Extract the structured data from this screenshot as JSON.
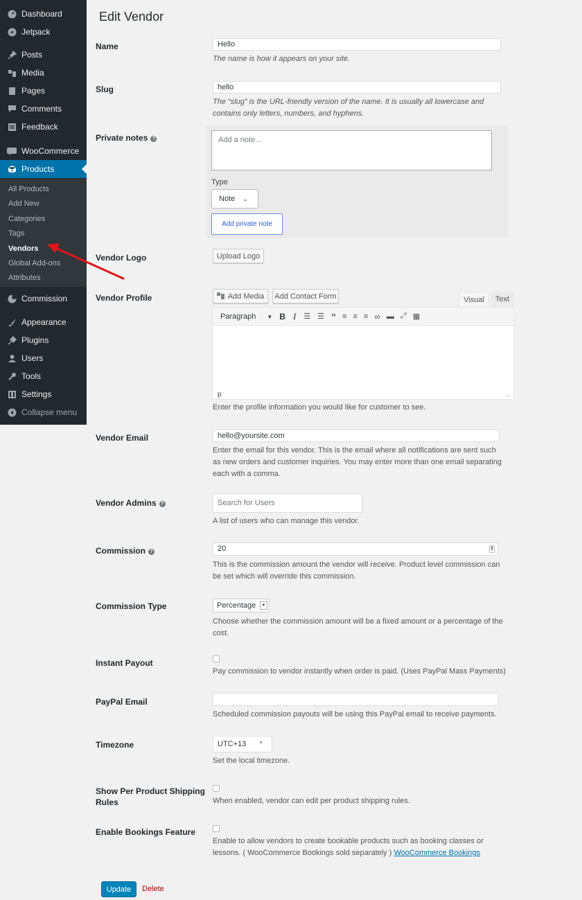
{
  "sidebar": {
    "menu": [
      {
        "label": "Dashboard",
        "icon": "dashboard-icon"
      },
      {
        "label": "Jetpack",
        "icon": "jetpack-icon"
      },
      {
        "label": "Posts",
        "icon": "pin-icon"
      },
      {
        "label": "Media",
        "icon": "media-icon"
      },
      {
        "label": "Pages",
        "icon": "page-icon"
      },
      {
        "label": "Comments",
        "icon": "comment-icon"
      },
      {
        "label": "Feedback",
        "icon": "feedback-icon"
      },
      {
        "label": "WooCommerce",
        "icon": "woocommerce-icon"
      },
      {
        "label": "Products",
        "icon": "products-icon"
      }
    ],
    "submenu": [
      "All Products",
      "Add New",
      "Categories",
      "Tags",
      "Vendors",
      "Global Add-ons",
      "Attributes"
    ],
    "menu2": [
      {
        "label": "Commission",
        "icon": "pie-chart-icon"
      },
      {
        "label": "Appearance",
        "icon": "brush-icon"
      },
      {
        "label": "Plugins",
        "icon": "plugin-icon"
      },
      {
        "label": "Users",
        "icon": "users-icon"
      },
      {
        "label": "Tools",
        "icon": "wrench-icon"
      },
      {
        "label": "Settings",
        "icon": "settings-icon"
      },
      {
        "label": "Collapse menu",
        "icon": "collapse-icon"
      }
    ]
  },
  "page": {
    "title": "Edit Vendor",
    "name": {
      "label": "Name",
      "value": "Hello",
      "desc": "The name is how it appears on your site."
    },
    "slug": {
      "label": "Slug",
      "value": "hello",
      "desc1": "The “slug” is the URL-friendly version of the name. It is usually all lowercase and",
      "desc2": "contains only letters, numbers, and hyphens."
    },
    "notes": {
      "label": "Private notes",
      "placeholder": "Add a note...",
      "type_label": "Type",
      "type_value": "Note",
      "add_button": "Add private note"
    },
    "logo": {
      "label": "Vendor Logo",
      "button": "Upload Logo"
    },
    "profile": {
      "label": "Vendor Profile",
      "add_media": "Add Media",
      "add_contact": "Add Contact Form",
      "tab_visual": "Visual",
      "tab_text": "Text",
      "format": "Paragraph",
      "path": "p",
      "desc": "Enter the profile information you would like for customer to see."
    },
    "email": {
      "label": "Vendor Email",
      "value": "hello@yoursite.com",
      "desc1": "Enter the email for this vendor. This is the email where all notifications are sent such",
      "desc2": "as new orders and customer inquiries. You may enter more than one email separating",
      "desc3": "each with a comma."
    },
    "admins": {
      "label": "Vendor Admins",
      "placeholder": "Search for Users",
      "desc": "A list of users who can manage this vendor."
    },
    "commission": {
      "label": "Commission",
      "value": "20",
      "desc1": "This is the commission amount the vendor will receive. Product level commission can",
      "desc2": "be set which will override this commission."
    },
    "commission_type": {
      "label": "Commission Type",
      "value": "Percentage",
      "desc1": "Choose whether the commission amount will be a fixed amount or a percentage of the",
      "desc2": "cost."
    },
    "instant_payout": {
      "label": "Instant Payout",
      "desc": "Pay commission to vendor instantly when order is paid. (Uses PayPal Mass Payments)"
    },
    "paypal": {
      "label": "PayPal Email",
      "value": "",
      "desc": "Scheduled commission payouts will be using this PayPal email to receive payments."
    },
    "timezone": {
      "label": "Timezone",
      "value": "UTC+13",
      "desc": "Set the local timezone."
    },
    "shipping": {
      "label1": "Show Per Product Shipping",
      "label2": "Rules",
      "desc": "When enabled, vendor can edit per product shipping rules."
    },
    "bookings": {
      "label": "Enable Bookings Feature",
      "desc1": "Enable to allow vendors to create bookable products such as booking classes or",
      "desc2": "lessons. ( WooCommerce Bookings sold separately )",
      "link": "WooCommerce Bookings"
    },
    "update_button": "Update",
    "delete_link": "Delete"
  },
  "colors": {
    "sidebar_bg": "#23282d",
    "active_bg": "#0073aa",
    "delete": "#a00",
    "arrow": "#e0161a"
  }
}
